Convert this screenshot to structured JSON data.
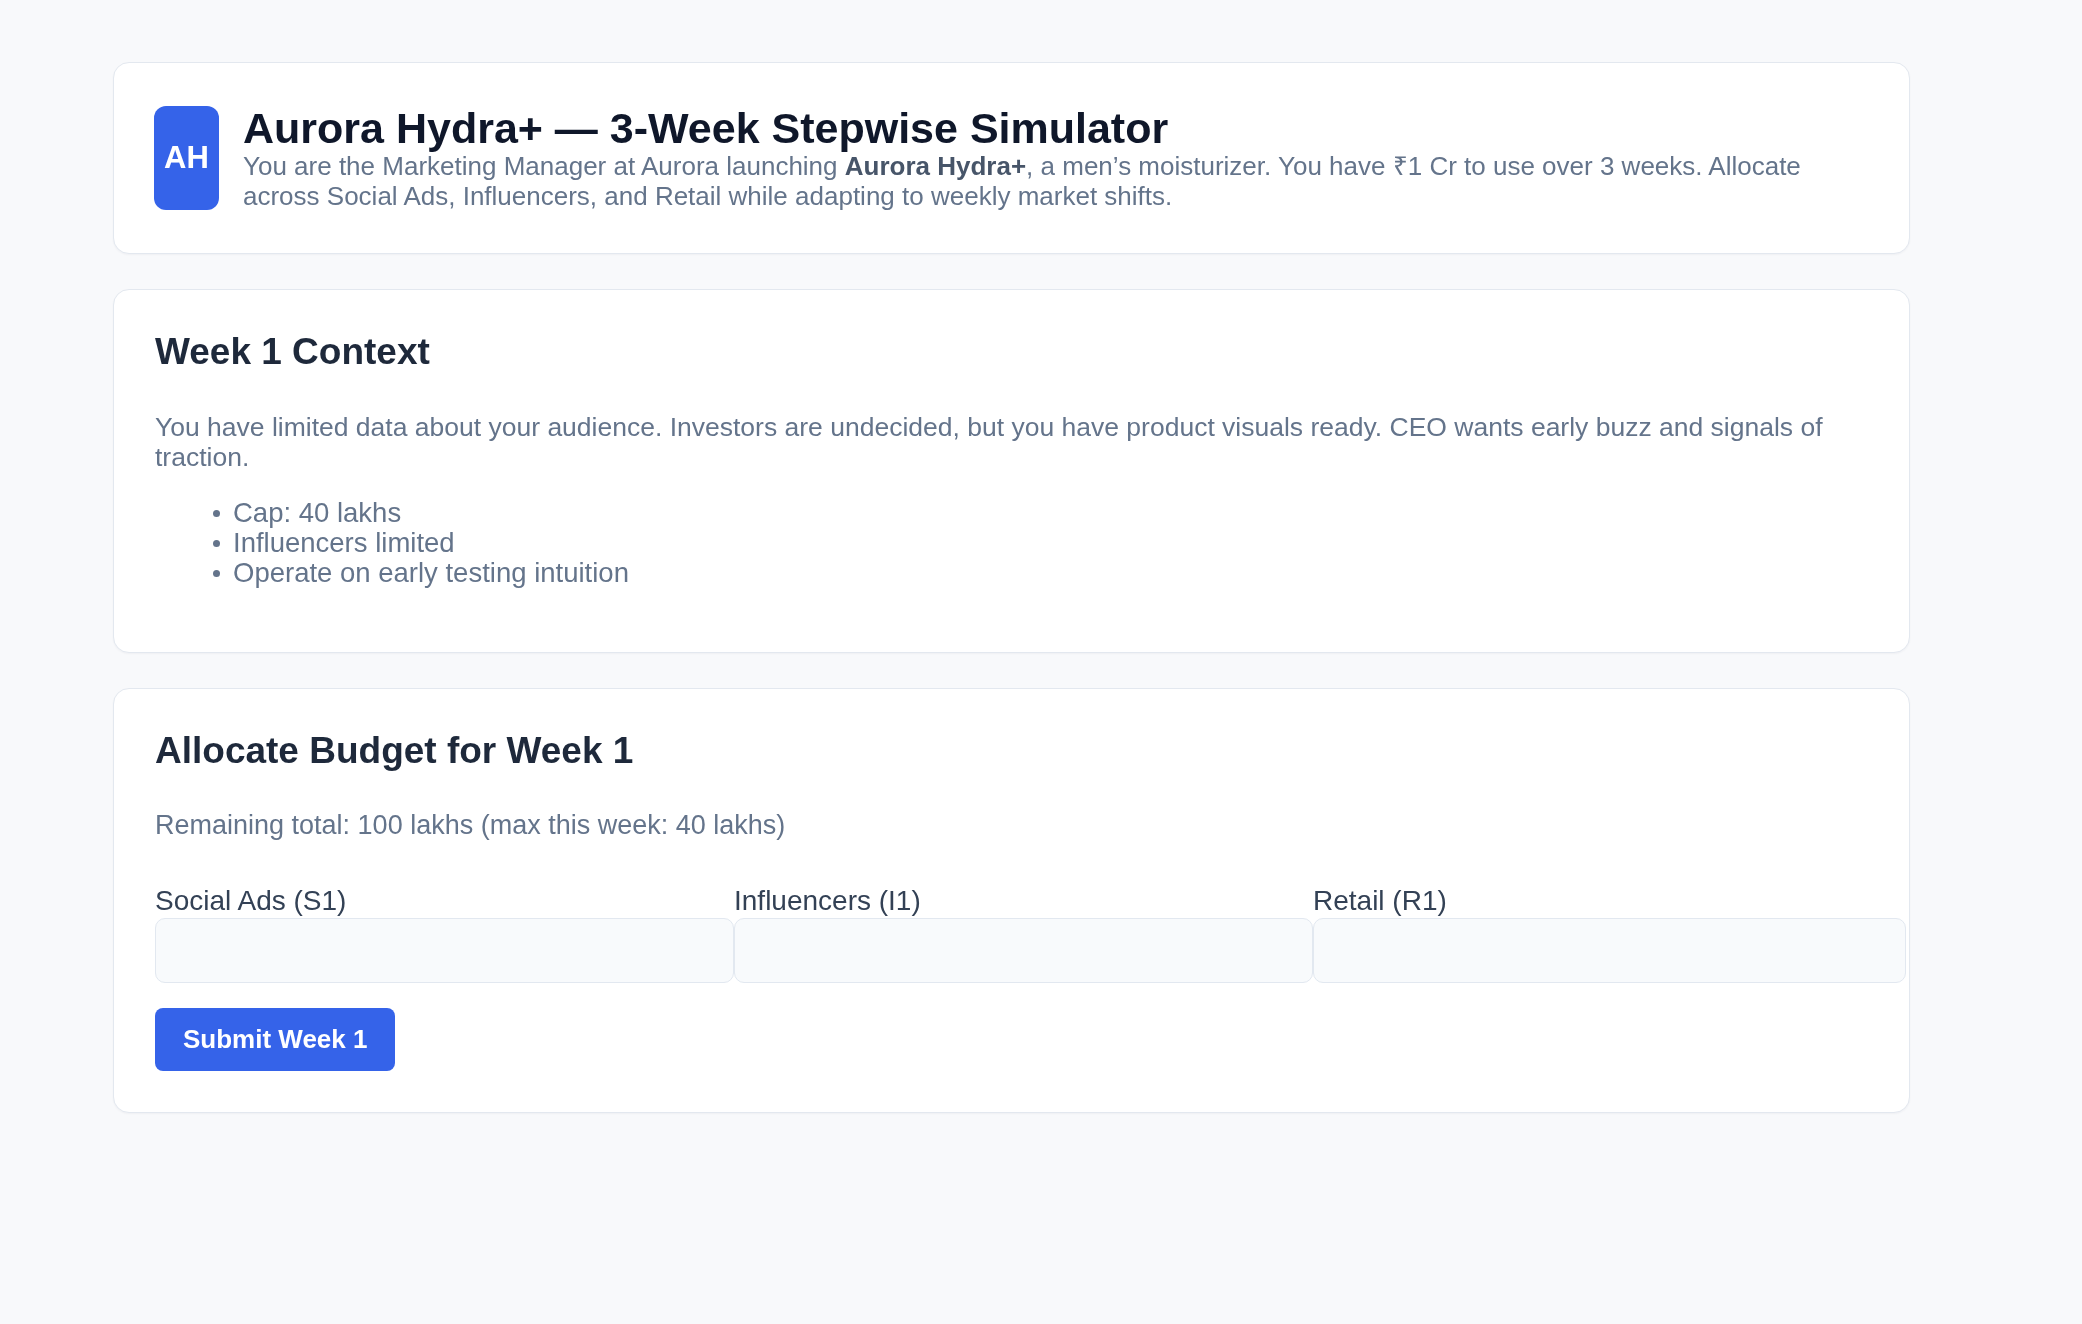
{
  "header": {
    "logo": "AH",
    "title": "Aurora Hydra+ — 3-Week Stepwise Simulator",
    "description": "You are the Marketing Manager at Aurora launching **Aurora Hydra+**, a men’s moisturizer. You have ₹1 Cr to use over 3 weeks. Allocate across Social Ads, Influencers, and Retail while adapting to weekly market shifts."
  },
  "context": {
    "heading": "Week 1 Context",
    "paragraph": "You have limited data about your audience. Investors are undecided, but you have product visuals ready. CEO wants early buzz and signals of traction.",
    "bullets": [
      "Cap: 40 lakhs",
      "Influencers limited",
      "Operate on early testing intuition"
    ]
  },
  "allocation": {
    "heading": "Allocate Budget for Week 1",
    "remaining": "Remaining total: 100 lakhs (max this week: 40 lakhs)",
    "fields": [
      {
        "label": "Social Ads (S1)"
      },
      {
        "label": "Influencers (I1)"
      },
      {
        "label": "Retail (R1)"
      }
    ],
    "submit": "Submit Week 1"
  }
}
